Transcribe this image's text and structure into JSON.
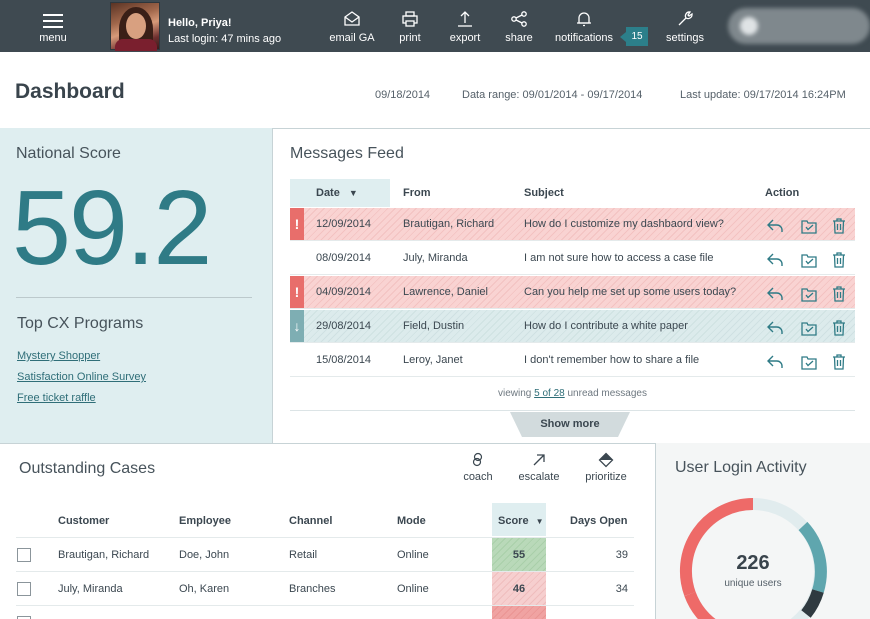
{
  "topbar": {
    "menu_label": "menu",
    "greeting": "Hello, Priya!",
    "last_login": "Last login: 47 mins ago",
    "tools": [
      {
        "label": "email GA",
        "icon": "envelope-icon"
      },
      {
        "label": "print",
        "icon": "printer-icon"
      },
      {
        "label": "export",
        "icon": "upload-icon"
      },
      {
        "label": "share",
        "icon": "share-icon"
      },
      {
        "label": "notifications",
        "icon": "bell-icon"
      },
      {
        "label": "settings",
        "icon": "wrench-icon"
      }
    ],
    "notification_count": "15"
  },
  "header": {
    "title": "Dashboard",
    "date": "09/18/2014",
    "data_range": "Data range: 09/01/2014 - 09/17/2014",
    "last_update": "Last update: 09/17/2014  16:24PM"
  },
  "national": {
    "title": "National Score",
    "score": "59.2",
    "programs_title": "Top CX Programs",
    "programs": [
      "Mystery Shopper",
      "Satisfaction Online Survey",
      "Free ticket raffle"
    ]
  },
  "messages": {
    "title": "Messages Feed",
    "columns": {
      "date": "Date",
      "from": "From",
      "subject": "Subject",
      "action": "Action"
    },
    "rows": [
      {
        "flag": "!",
        "date": "12/09/2014",
        "from": "Brautigan, Richard",
        "subject": "How do I customize my dashbaord view?"
      },
      {
        "flag": "",
        "date": "08/09/2014",
        "from": "July, Miranda",
        "subject": "I am not sure how to access a case file"
      },
      {
        "flag": "!",
        "date": "04/09/2014",
        "from": "Lawrence, Daniel",
        "subject": "Can you help me set up some users today?"
      },
      {
        "flag": "↓",
        "date": "29/08/2014",
        "from": "Field, Dustin",
        "subject": "How do I contribute a white paper"
      },
      {
        "flag": "",
        "date": "15/08/2014",
        "from": "Leroy, Janet",
        "subject": "I don't remember how to share a file"
      }
    ],
    "viewing_prefix": "viewing",
    "viewing_link": "5 of 28",
    "viewing_suffix": "unread messages",
    "show_more": "Show more"
  },
  "cases": {
    "title": "Outstanding Cases",
    "tools": [
      {
        "label": "coach",
        "icon": "coach-icon"
      },
      {
        "label": "escalate",
        "icon": "arrow-up-right-icon"
      },
      {
        "label": "prioritize",
        "icon": "diamond-icon"
      }
    ],
    "columns": {
      "customer": "Customer",
      "employee": "Employee",
      "channel": "Channel",
      "mode": "Mode",
      "score": "Score",
      "days": "Days Open"
    },
    "rows": [
      {
        "customer": "Brautigan, Richard",
        "employee": "Doe, John",
        "channel": "Retail",
        "mode": "Online",
        "score": "55",
        "days": "39"
      },
      {
        "customer": "July, Miranda",
        "employee": "Oh, Karen",
        "channel": "Branches",
        "mode": "Online",
        "score": "46",
        "days": "34"
      }
    ]
  },
  "login_activity": {
    "title": "User Login Activity",
    "count": "226",
    "unit": "unique users"
  },
  "colors": {
    "topbar": "#3f4a51",
    "accent_teal": "#2f7b86",
    "alert_red": "#e86e6b",
    "panel_teal_bg": "#dfeef0"
  }
}
